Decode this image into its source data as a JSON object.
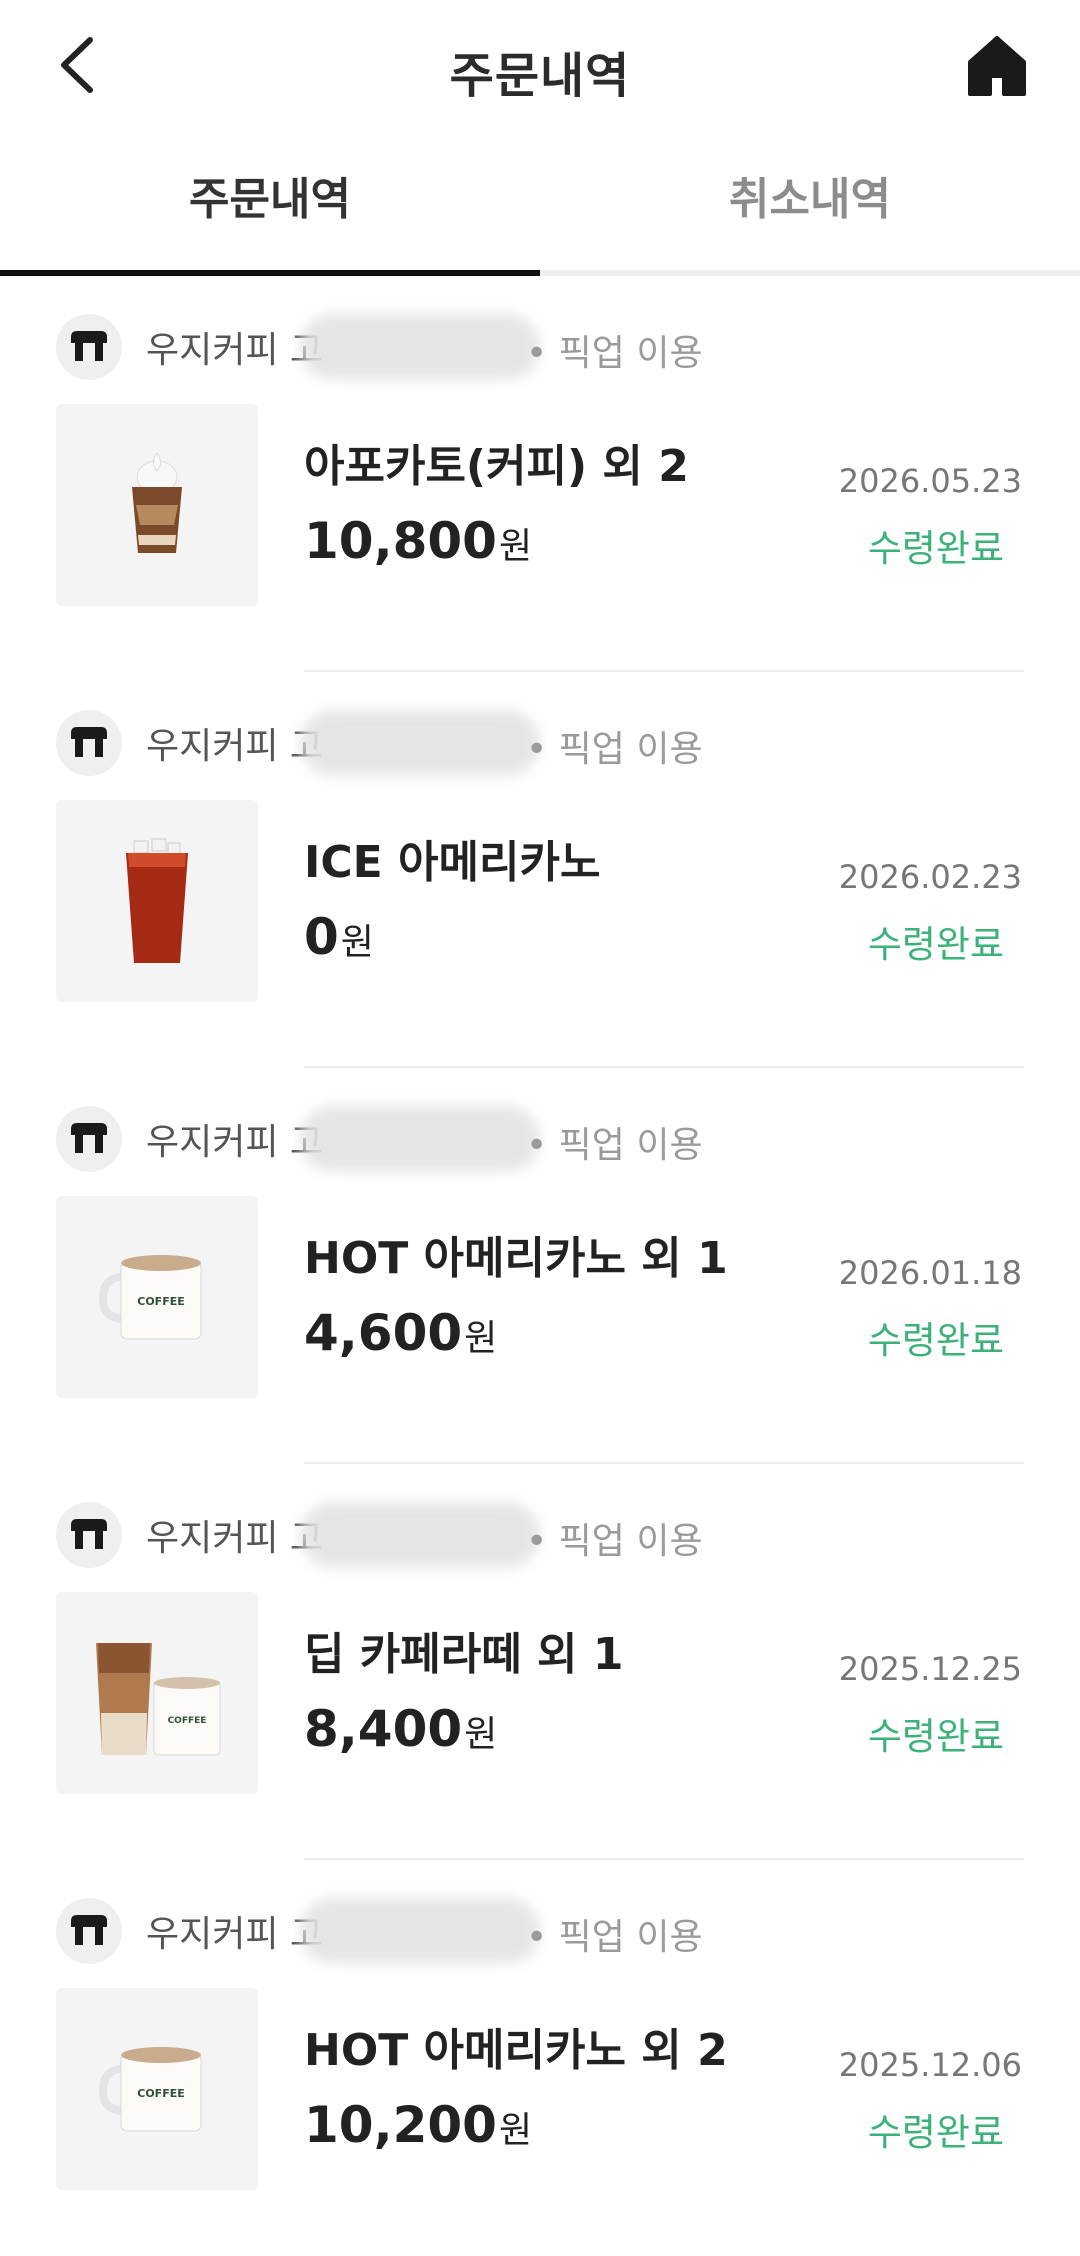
{
  "header": {
    "title": "주문내역",
    "back_icon": "chevron-left-icon",
    "home_icon": "home-icon"
  },
  "tabs": [
    {
      "label": "주문내역",
      "active": true
    },
    {
      "label": "취소내역",
      "active": false
    }
  ],
  "orders": [
    {
      "store_prefix": "우지커피 고",
      "pickup": "• 픽업 이용",
      "item": "아포카토(커피) 외 2",
      "price": "10,800",
      "unit": "원",
      "date": "2026.05.23",
      "status": "수령완료",
      "image": "affogato-image"
    },
    {
      "store_prefix": "우지커피 고",
      "pickup": "• 픽업 이용",
      "item": "ICE 아메리카노",
      "price": "0",
      "unit": "원",
      "date": "2026.02.23",
      "status": "수령완료",
      "image": "iced-americano-image"
    },
    {
      "store_prefix": "우지커피 고",
      "pickup": "• 픽업 이용",
      "item": "HOT 아메리카노 외 1",
      "price": "4,600",
      "unit": "원",
      "date": "2026.01.18",
      "status": "수령완료",
      "image": "hot-americano-mug-image"
    },
    {
      "store_prefix": "우지커피 고",
      "pickup": "• 픽업 이용",
      "item": "딥 카페라떼 외 1",
      "price": "8,400",
      "unit": "원",
      "date": "2025.12.25",
      "status": "수령완료",
      "image": "cafe-latte-image"
    },
    {
      "store_prefix": "우지커피 고",
      "pickup": "• 픽업 이용",
      "item": "HOT 아메리카노 외 2",
      "price": "10,200",
      "unit": "원",
      "date": "2025.12.06",
      "status": "수령완료",
      "image": "hot-americano-mug-image"
    }
  ],
  "colors": {
    "status_green": "#3bb27a",
    "tab_underline": "#111111"
  }
}
